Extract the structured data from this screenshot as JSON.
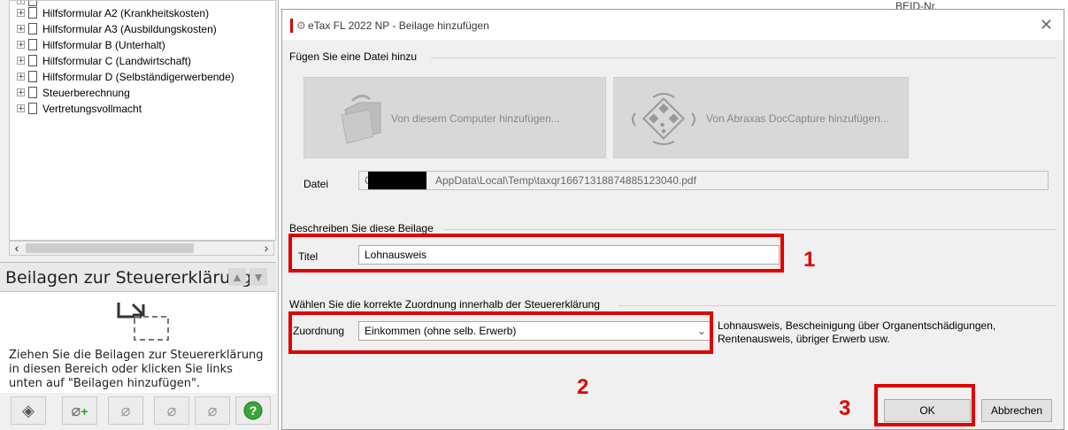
{
  "tree": {
    "items": [
      {
        "label": "Hilfsformular A2 (Krankheitskosten)"
      },
      {
        "label": "Hilfsformular A3 (Ausbildungskosten)"
      },
      {
        "label": "Hilfsformular B (Unterhalt)"
      },
      {
        "label": "Hilfsformular C (Landwirtschaft)"
      },
      {
        "label": "Hilfsformular D (Selbständigerwerbende)"
      },
      {
        "label": "Steuerberechnung"
      },
      {
        "label": "Vertretungsvollmacht"
      }
    ]
  },
  "beilagen": {
    "title": "Beilagen zur Steuererklärung",
    "drop_text": "Ziehen Sie die Beilagen zur Steuererklärung\nin diesen Bereich oder klicken Sie links\nunten auf \"Beilagen hinzufügen\"."
  },
  "dialog": {
    "title": "eTax FL 2022 NP - Beilage hinzufügen",
    "section_add": "Fügen Sie eine Datei hinzu",
    "btn_computer": "Von diesem Computer hinzufügen...",
    "btn_doccapture": "Von Abraxas DocCapture hinzufügen...",
    "datei_label": "Datei",
    "datei_prefix": "C:",
    "datei_value": "AppData\\Local\\Temp\\taxqr16671318874885123040.pdf",
    "section_describe": "Beschreiben Sie diese Beilage",
    "titel_label": "Titel",
    "titel_value": "Lohnausweis",
    "section_zuordnung": "Wählen Sie die korrekte Zuordnung innerhalb der Steuererklärung",
    "zuordnung_label": "Zuordnung",
    "zuordnung_value": "Einkommen (ohne selb. Erwerb)",
    "zuordnung_desc": "Lohnausweis, Bescheinigung über Organentschädigungen,\nRentenausweis, übriger Erwerb usw.",
    "ok": "OK",
    "cancel": "Abbrechen"
  },
  "annotations": [
    "1",
    "2",
    "3"
  ],
  "right_fragment": "BEID-Nr.",
  "colors": {
    "annotation": "#e00000",
    "accent": "#d10000"
  },
  "icons": [
    "expander-plus-icon",
    "document-icon",
    "folder-icon",
    "qr-scan-icon",
    "chevron-down-icon",
    "close-icon",
    "help-icon",
    "attachment-add-icon"
  ]
}
